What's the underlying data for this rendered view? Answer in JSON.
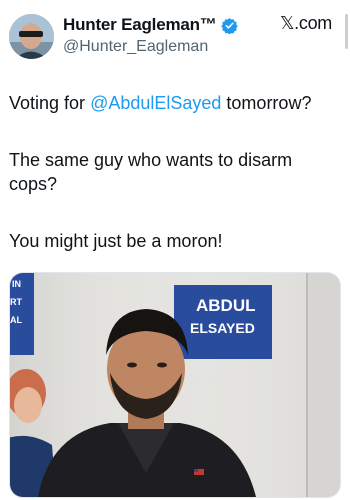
{
  "author": {
    "display_name": "Hunter Eagleman™",
    "handle": "@Hunter_Eagleman",
    "verified_icon": "verified-badge-icon",
    "avatar": "profile-photo"
  },
  "site_label": "𝕏.com",
  "tweet": {
    "line1_prefix": "Voting for ",
    "mention": "@AbdulElSayed",
    "line1_suffix": " tomorrow?",
    "line2a": "The same guy who wants to disarm",
    "line2b": "cops?",
    "line3": "You might just be a moron!"
  },
  "media": {
    "description_icon": "photo",
    "sign_text_line1": "ABDUL",
    "sign_text_line2": "ELSAYED"
  },
  "colors": {
    "mention": "#1d9bf0",
    "verified": "#1d9bf0",
    "text": "#0f1419",
    "muted": "#536471",
    "sign": "#2a4c9c"
  }
}
